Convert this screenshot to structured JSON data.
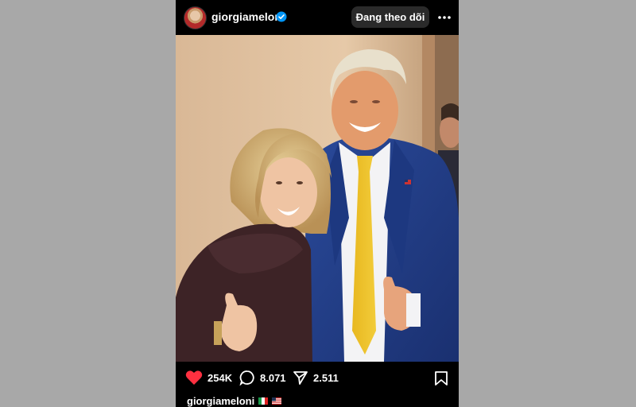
{
  "post": {
    "username": "giorgiameloni",
    "follow_label": "Đang theo dõi",
    "likes": "254K",
    "comments": "8.071",
    "shares": "2.511",
    "caption_username": "giorgiameloni",
    "caption_flags": [
      "italy-flag",
      "usa-flag"
    ]
  },
  "colors": {
    "background": "#a8a8a8",
    "app": "#000000",
    "like_red": "#ff3040",
    "verified_blue": "#0095f6",
    "follow_button": "#2a2a2a"
  },
  "icons": [
    "verified-badge-icon",
    "more-options-icon",
    "heart-icon",
    "comment-icon",
    "share-icon",
    "save-icon"
  ]
}
